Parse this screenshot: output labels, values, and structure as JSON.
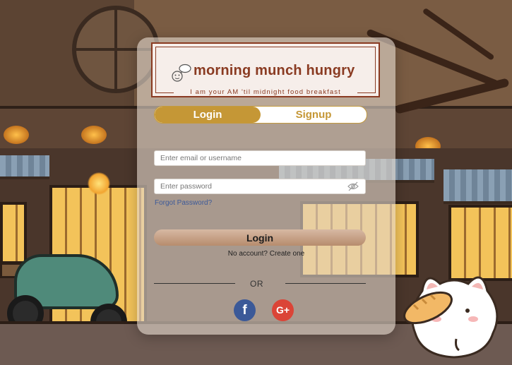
{
  "brand": {
    "title": "morning munch hungry",
    "tagline": "I am your AM 'til midnight food breakfast",
    "icon": "bubble-face-icon",
    "color": "#8a3b22"
  },
  "auth_toggle": {
    "active_tab": "Login",
    "inactive_tab": "Signup",
    "accent": "#c59736"
  },
  "form": {
    "email_placeholder": "Enter email or username",
    "password_placeholder": "Enter password",
    "password_toggle_icon": "eye-slash-icon",
    "forgot_label": "Forgot Password?",
    "submit_label": "Login",
    "no_account_label": "No account? Create one"
  },
  "social": {
    "divider_label": "OR",
    "facebook_glyph": "f",
    "google_glyph": "G+",
    "facebook_color": "#3b5998",
    "google_color": "#db4437"
  },
  "background": {
    "scene": "cozy-street-night",
    "mascot": "cat-eating-bread"
  }
}
